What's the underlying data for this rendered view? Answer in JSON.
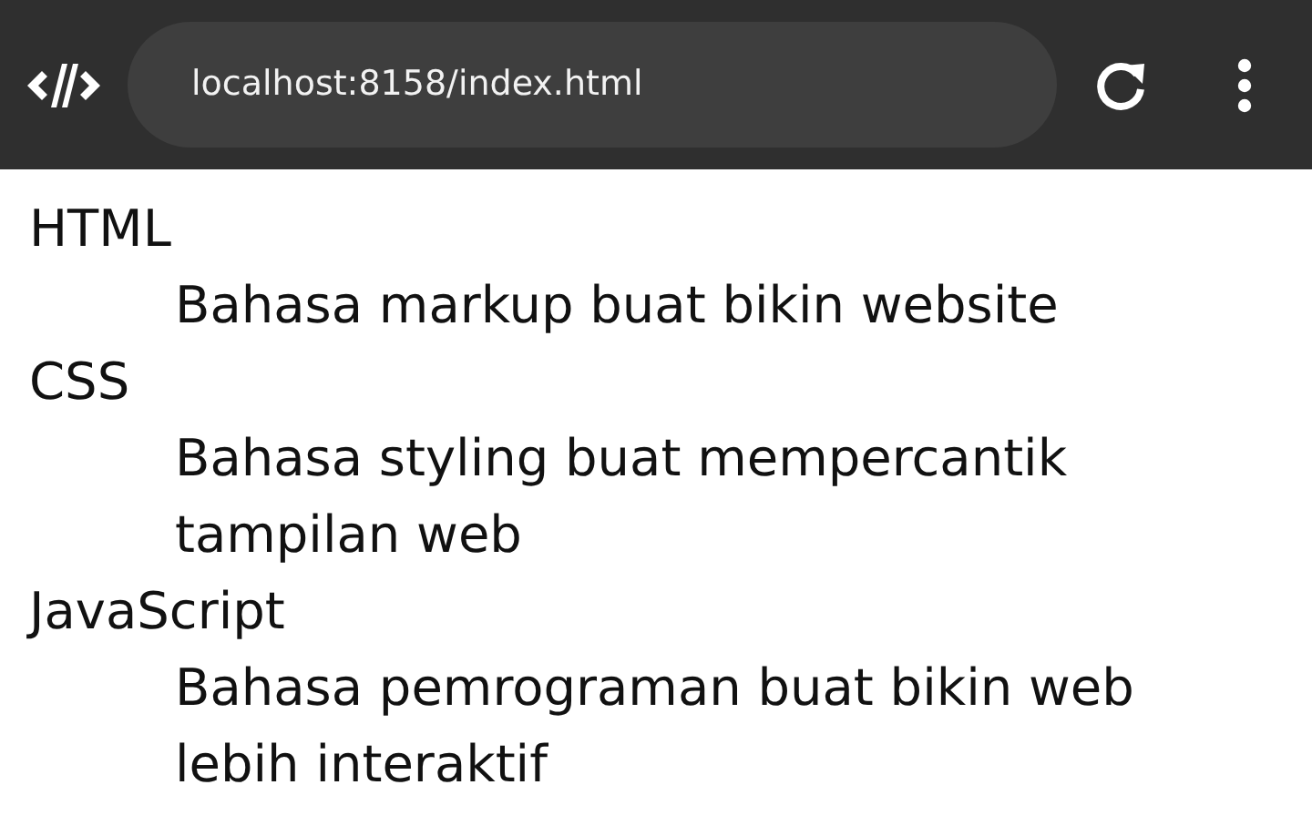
{
  "address_bar": {
    "url": "localhost:8158/index.html"
  },
  "definitions": [
    {
      "term": "HTML",
      "description": "Bahasa markup buat bikin website"
    },
    {
      "term": "CSS",
      "description": "Bahasa styling buat mempercantik tampilan web"
    },
    {
      "term": "JavaScript",
      "description": "Bahasa pemrograman buat bikin web lebih interaktif"
    }
  ]
}
